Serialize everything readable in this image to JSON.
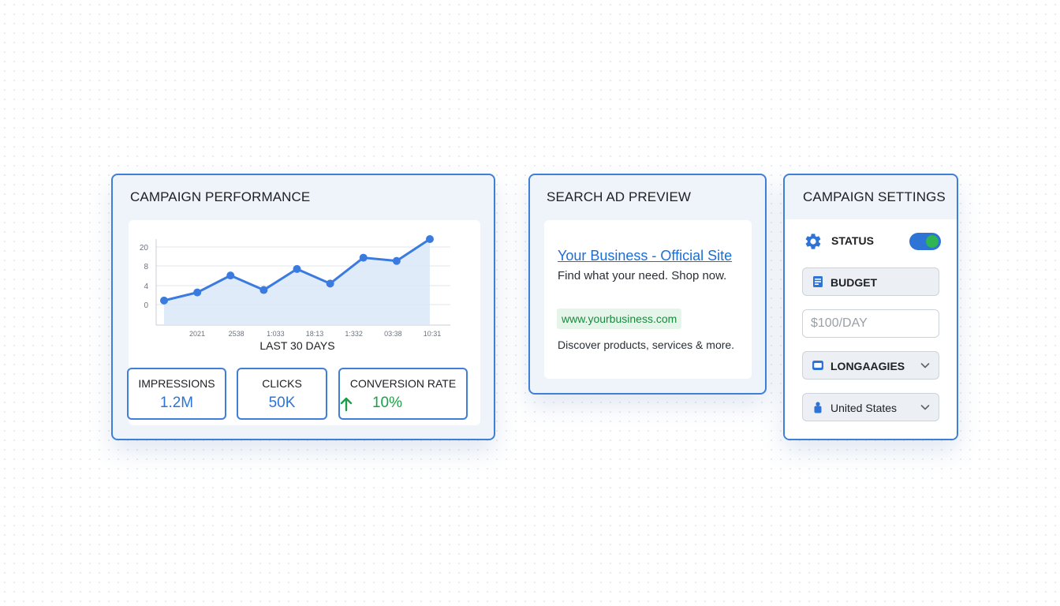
{
  "performance": {
    "title": "CAMPAIGN PERFORMANCE",
    "chart_data": {
      "type": "area",
      "title": "",
      "xlabel": "LAST 30 DAYS",
      "ylabel": "",
      "y_ticks": [
        "0",
        "4",
        "8",
        "20"
      ],
      "x_tick_labels": [
        "2021",
        "2538",
        "1:033",
        "18:13",
        "1:332",
        "03:38",
        "10:31"
      ],
      "series": [
        {
          "values": [
            0.5,
            1.5,
            3.6,
            1.8,
            4.4,
            2.6,
            5.8,
            5.4,
            8.1
          ]
        }
      ],
      "grid": true,
      "legend": "none",
      "color": "#3b7be0",
      "fill_color": "#dbe7f9"
    },
    "metrics": {
      "impressions": {
        "label": "IMPRESSIONS",
        "value": "1.2M"
      },
      "clicks": {
        "label": "CLICKS",
        "value": "50K"
      },
      "conversion": {
        "label": "CONVERSION RATE",
        "value": "10%",
        "trend_icon": "arrow-up-icon"
      }
    }
  },
  "ad_preview": {
    "title": "SEARCH AD PREVIEW",
    "headline": "Your Business - Official Site",
    "description1": "Find what your need. Shop now.",
    "display_url": "www.yourbusiness.com",
    "description2": "Discover products, services & more."
  },
  "settings": {
    "title": "CAMPAIGN SETTINGS",
    "status_label": "STATUS",
    "status_on": true,
    "budget_label": "BUDGET",
    "budget_placeholder": "$100/DAY",
    "languages_label": "LONGAAGIES",
    "country_value": "United States",
    "icons": [
      "gear-icon",
      "budget-icon",
      "languages-icon",
      "location-icon",
      "chevron-down-icon"
    ]
  },
  "colors": {
    "accent": "#3f7fd8",
    "link": "#1a6ed8",
    "positive": "#1e9e4a"
  }
}
